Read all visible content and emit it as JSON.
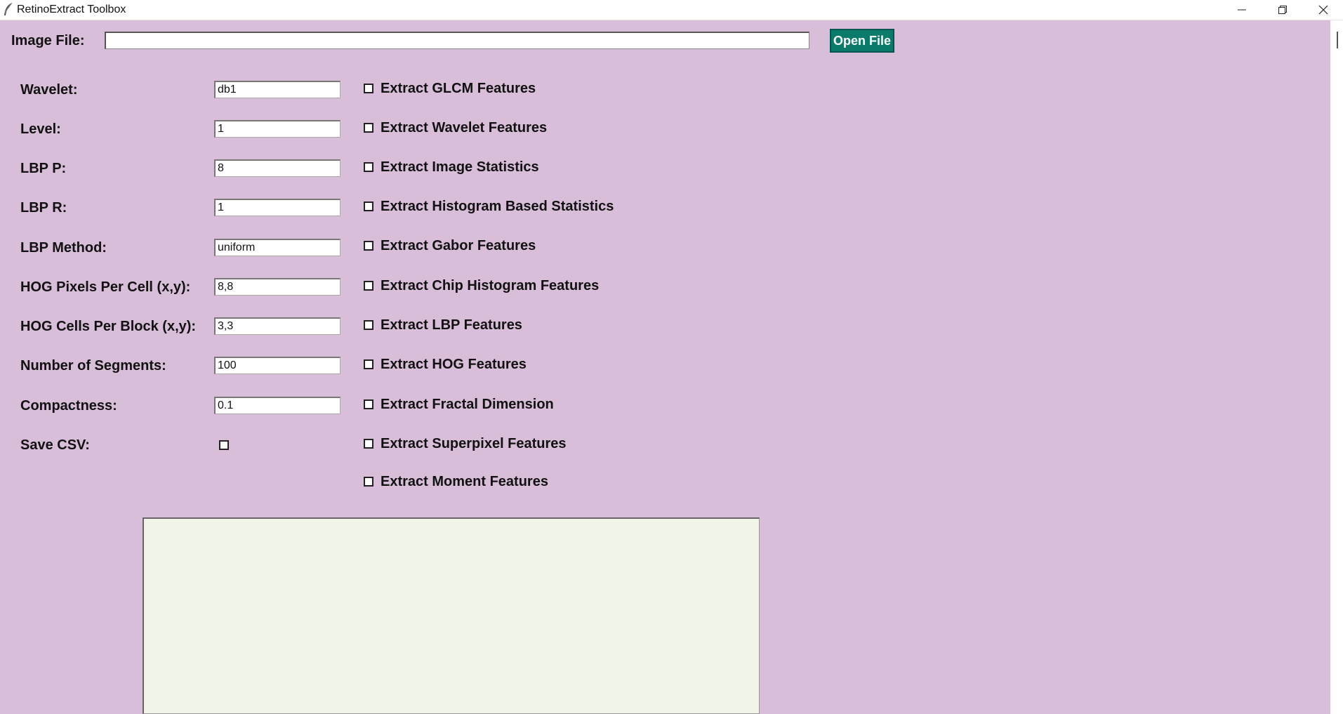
{
  "window": {
    "title": "RetinoExtract Toolbox"
  },
  "file": {
    "label": "Image File:",
    "value": "",
    "open_button": "Open File"
  },
  "params": [
    {
      "label": "Wavelet:",
      "value": "db1"
    },
    {
      "label": "Level:",
      "value": "1"
    },
    {
      "label": "LBP P:",
      "value": "8"
    },
    {
      "label": "LBP R:",
      "value": "1"
    },
    {
      "label": "LBP Method:",
      "value": "uniform"
    },
    {
      "label": "HOG Pixels Per Cell (x,y):",
      "value": "8,8"
    },
    {
      "label": "HOG Cells Per Block (x,y):",
      "value": "3,3"
    },
    {
      "label": "Number of Segments:",
      "value": "100"
    },
    {
      "label": "Compactness:",
      "value": "0.1"
    }
  ],
  "save_csv": {
    "label": "Save CSV:",
    "checked": false
  },
  "features": [
    {
      "label": "Extract GLCM Features",
      "checked": false
    },
    {
      "label": "Extract Wavelet Features",
      "checked": false
    },
    {
      "label": "Extract Image Statistics",
      "checked": false
    },
    {
      "label": "Extract Histogram Based Statistics",
      "checked": false
    },
    {
      "label": "Extract Gabor Features",
      "checked": false
    },
    {
      "label": "Extract Chip Histogram Features",
      "checked": false
    },
    {
      "label": "Extract LBP Features",
      "checked": false
    },
    {
      "label": "Extract HOG Features",
      "checked": false
    },
    {
      "label": "Extract Fractal Dimension",
      "checked": false
    },
    {
      "label": "Extract Superpixel Features",
      "checked": false
    },
    {
      "label": "Extract Moment Features",
      "checked": false
    }
  ],
  "icons": {
    "app": "feather-icon",
    "minimize": "minimize-icon",
    "maximize": "restore-icon",
    "close": "close-icon"
  },
  "colors": {
    "background": "#d8bed8",
    "button": "#0a7a6a",
    "output_background": "#f0f5e8"
  }
}
